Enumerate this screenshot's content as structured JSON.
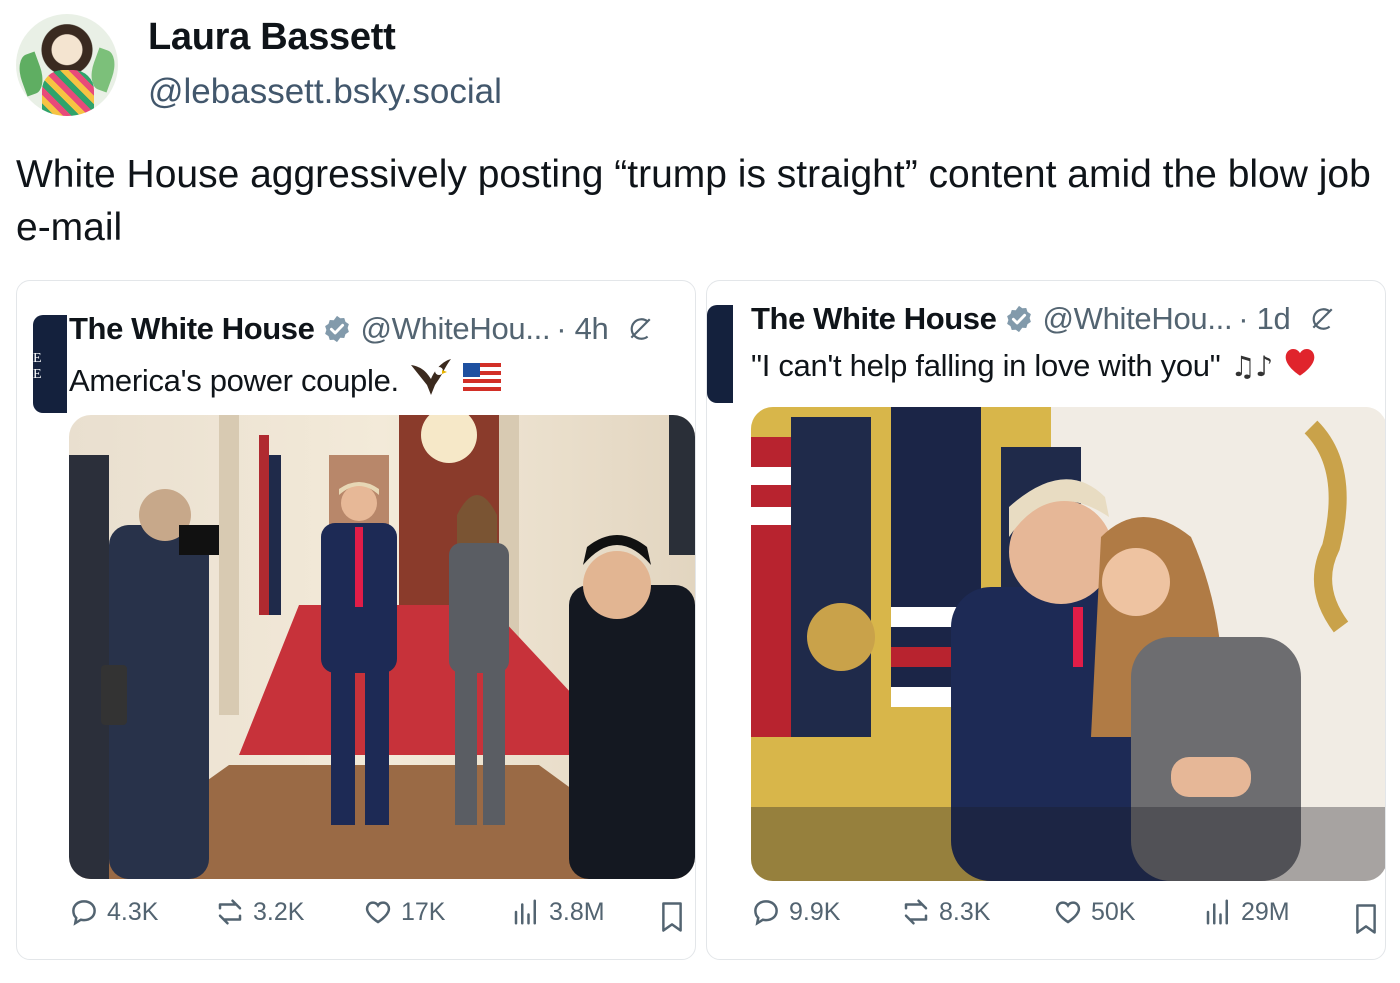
{
  "post": {
    "author_name": "Laura Bassett",
    "author_handle": "@lebassett.bsky.social",
    "text": "White House aggressively posting “trump is straight” content amid the blow job e-mail"
  },
  "embeds": [
    {
      "name": "The White House",
      "handle": "@WhiteHou...",
      "time": "· 4h",
      "text": "America's power couple.",
      "emojis": [
        "eagle-emoji",
        "us-flag-emoji"
      ],
      "stats": {
        "replies": "4.3K",
        "reposts": "3.2K",
        "likes": "17K",
        "views": "3.8M"
      }
    },
    {
      "name": "The White House",
      "handle": "@WhiteHou...",
      "time": "· 1d",
      "text": "\"I can't help falling in love with you\"",
      "emojis": [
        "music-notes-emoji",
        "red-heart-emoji"
      ],
      "stats": {
        "replies": "9.9K",
        "reposts": "8.3K",
        "likes": "50K",
        "views": "29M"
      }
    }
  ],
  "colors": {
    "verified": "#829aab",
    "muted": "#536471",
    "side_tab": "#14213d",
    "handle": "#42576c"
  }
}
